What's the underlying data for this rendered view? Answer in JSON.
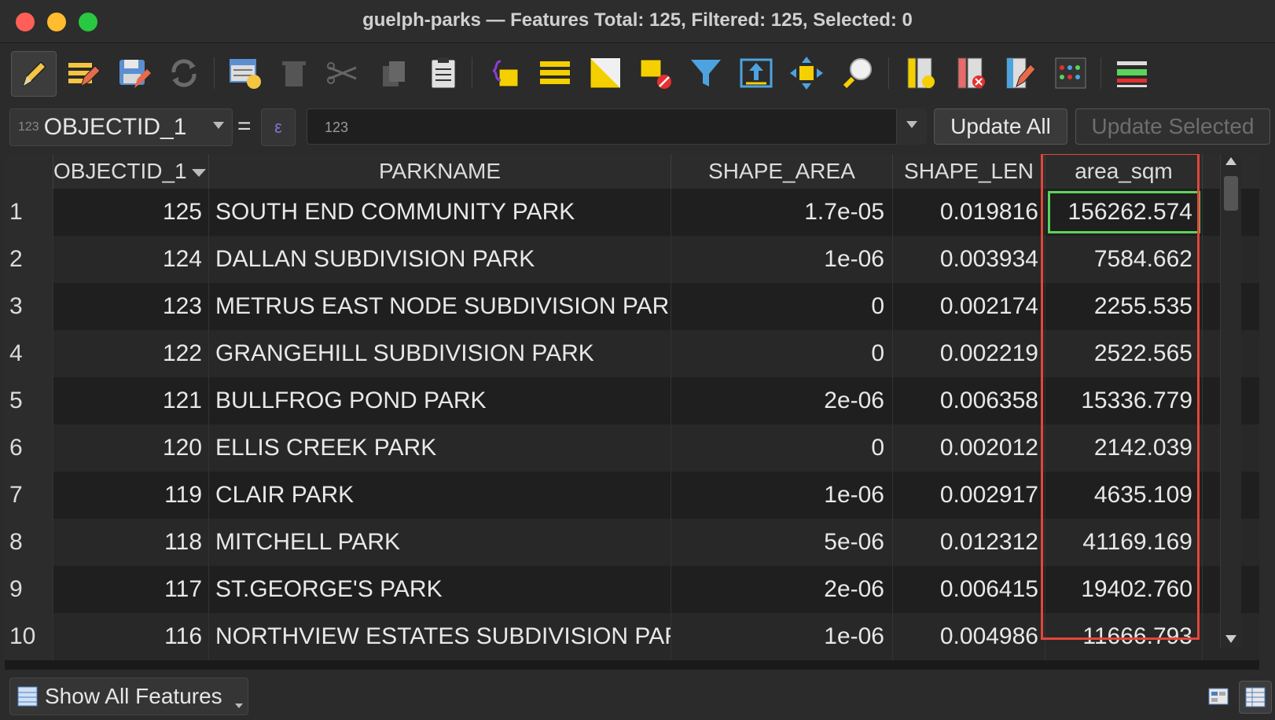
{
  "window": {
    "title": "guelph-parks — Features Total: 125, Filtered: 125, Selected: 0"
  },
  "toolbar": {
    "icons": [
      "toggle-editing-icon",
      "multi-edit-icon",
      "save-edits-icon",
      "reload-icon",
      "add-feature-icon",
      "delete-selected-icon",
      "cut-icon",
      "copy-icon",
      "paste-icon",
      "select-by-expression-icon",
      "select-all-icon",
      "invert-selection-icon",
      "deselect-all-icon",
      "filter-select-icon",
      "move-selection-top-icon",
      "pan-to-selection-icon",
      "zoom-to-selection-icon",
      "new-field-icon",
      "delete-field-icon",
      "field-calculator-icon",
      "conditional-formatting-icon",
      "dock-table-icon"
    ]
  },
  "calcbar": {
    "field_type": "123",
    "field": "OBJECTID_1",
    "equals": "=",
    "value_placeholder": "123",
    "update_all": "Update All",
    "update_selected": "Update Selected"
  },
  "table": {
    "headers": {
      "objectid": "OBJECTID_1",
      "parkname": "PARKNAME",
      "shape_area": "SHAPE_AREA",
      "shape_len": "SHAPE_LEN",
      "area_sqm": "area_sqm"
    },
    "rows": [
      {
        "n": "1",
        "id": "125",
        "name": "SOUTH END COMMUNITY PARK",
        "area": "1.7e-05",
        "len": "0.019816",
        "sqm": "156262.574"
      },
      {
        "n": "2",
        "id": "124",
        "name": "DALLAN SUBDIVISION PARK",
        "area": "1e-06",
        "len": "0.003934",
        "sqm": "7584.662"
      },
      {
        "n": "3",
        "id": "123",
        "name": "METRUS EAST NODE SUBDIVISION PARK",
        "area": "0",
        "len": "0.002174",
        "sqm": "2255.535"
      },
      {
        "n": "4",
        "id": "122",
        "name": "GRANGEHILL SUBDIVISION PARK",
        "area": "0",
        "len": "0.002219",
        "sqm": "2522.565"
      },
      {
        "n": "5",
        "id": "121",
        "name": "BULLFROG POND PARK",
        "area": "2e-06",
        "len": "0.006358",
        "sqm": "15336.779"
      },
      {
        "n": "6",
        "id": "120",
        "name": "ELLIS CREEK PARK",
        "area": "0",
        "len": "0.002012",
        "sqm": "2142.039"
      },
      {
        "n": "7",
        "id": "119",
        "name": "CLAIR PARK",
        "area": "1e-06",
        "len": "0.002917",
        "sqm": "4635.109"
      },
      {
        "n": "8",
        "id": "118",
        "name": "MITCHELL PARK",
        "area": "5e-06",
        "len": "0.012312",
        "sqm": "41169.169"
      },
      {
        "n": "9",
        "id": "117",
        "name": "ST.GEORGE'S PARK",
        "area": "2e-06",
        "len": "0.006415",
        "sqm": "19402.760"
      },
      {
        "n": "10",
        "id": "116",
        "name": "NORTHVIEW ESTATES SUBDIVISION PARK",
        "area": "1e-06",
        "len": "0.004986",
        "sqm": "11666.793"
      }
    ]
  },
  "bottombar": {
    "show_all": "Show All Features"
  },
  "colors": {
    "highlight_column": "#e2473a",
    "current_cell": "#5cd35c"
  }
}
